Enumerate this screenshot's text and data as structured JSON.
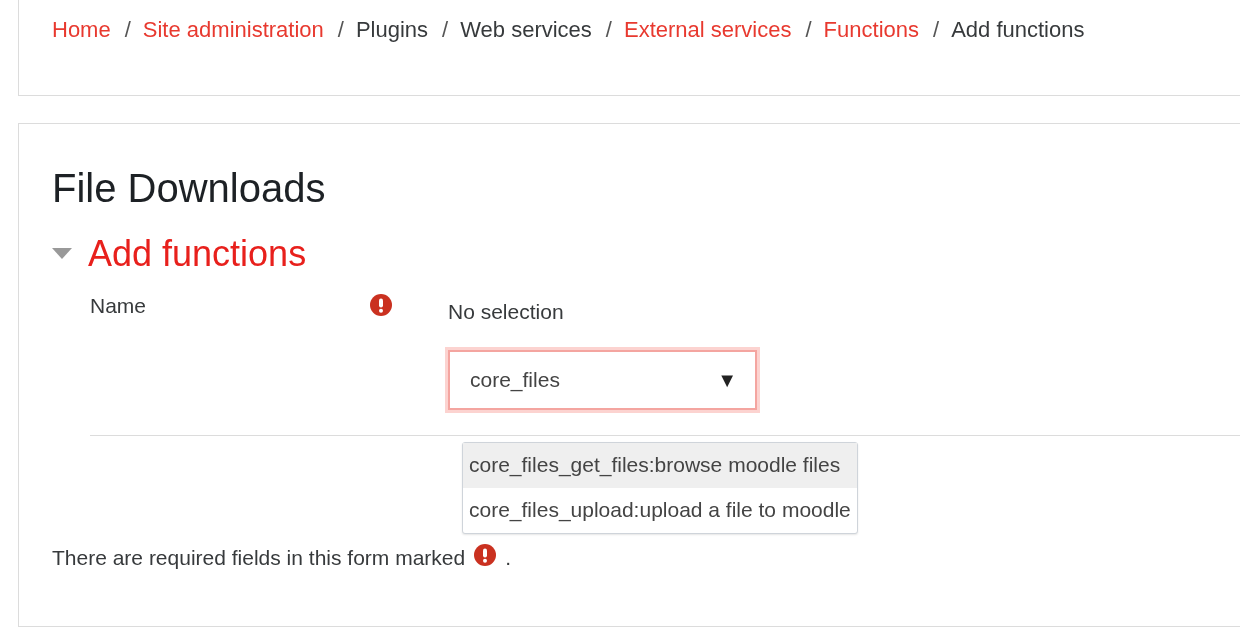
{
  "breadcrumbs": [
    {
      "label": "Home",
      "link": true
    },
    {
      "label": "Site administration",
      "link": true
    },
    {
      "label": "Plugins",
      "link": false
    },
    {
      "label": "Web services",
      "link": false
    },
    {
      "label": "External services",
      "link": true
    },
    {
      "label": "Functions",
      "link": true
    },
    {
      "label": "Add functions",
      "link": false
    }
  ],
  "separator": "/",
  "page_title": "File Downloads",
  "section": {
    "title": "Add functions",
    "expanded": true
  },
  "field": {
    "label": "Name",
    "required": true,
    "selection": "No selection",
    "value": "core_files",
    "arrow": "▼"
  },
  "options": [
    {
      "label": "core_files_get_files:browse moodle files",
      "selected": true
    },
    {
      "label": "core_files_upload:upload a file to moodle",
      "selected": false
    }
  ],
  "required_note": {
    "text": "There are required fields in this form marked",
    "end": "."
  }
}
